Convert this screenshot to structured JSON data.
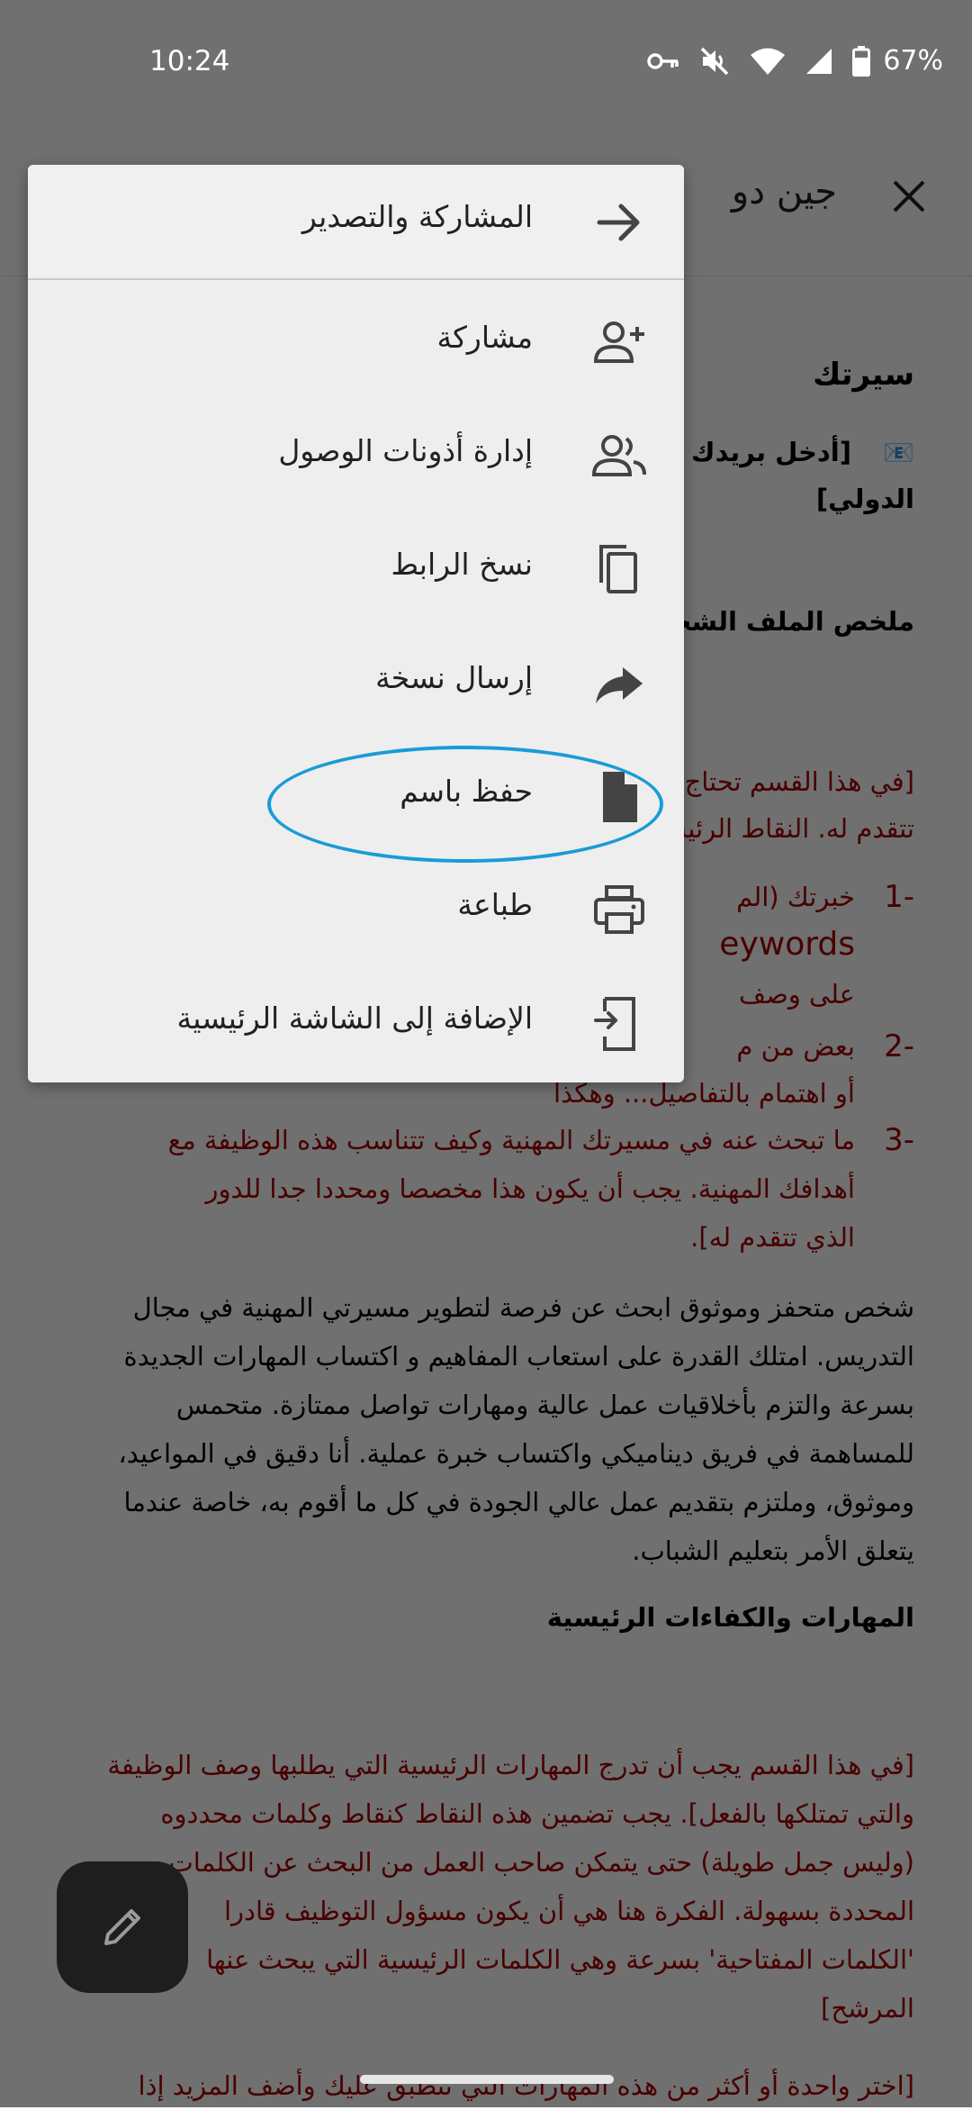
{
  "status": {
    "time": "10:24",
    "battery": "67%"
  },
  "document": {
    "title": "جين دو",
    "heading": "سيرتك",
    "email_line_1": "[أدخل بريدك ا",
    "email_line_2": "الدولي]",
    "section_profile": "ملخص الملف الشخص",
    "profile_note_1": "[في هذا القسم تحتاج",
    "profile_note_2": "تتقدم له. النقاط الرئيسي",
    "list_1a": "خبرتك (الم",
    "list_1b": "eywords",
    "list_1c": "على وصف",
    "list_2a": "بعض من م",
    "list_2b": "أو اهتمام بالتفاصيل... وهكذا",
    "list_3a": "ما تبحث عنه في مسيرتك المهنية وكيف تتناسب هذه الوظيفة مع",
    "list_3b": "أهدافك المهنية. يجب أن يكون هذا مخصصا ومحددا جدا للدور",
    "list_3c": "الذي تتقدم له].",
    "num_1": "-1",
    "num_2": "-2",
    "num_3": "-3",
    "summary_1": "شخص متحفز وموثوق ابحث عن فرصة لتطوير مسيرتي المهنية في مجال",
    "summary_2": "التدريس. امتلك القدرة على استعاب المفاهيم و اكتساب المهارات الجديدة",
    "summary_3": "بسرعة والتزم بأخلاقيات عمل عالية ومهارات تواصل ممتازة. متحمس",
    "summary_4": "للمساهمة في فريق ديناميكي واكتساب خبرة عملية. أنا دقيق في المواعيد،",
    "summary_5": "وموثوق، وملتزم بتقديم عمل عالي الجودة في كل ما أقوم به، خاصة عندما",
    "summary_6": "يتعلق الأمر بتعليم الشباب.",
    "section_skills": "المهارات والكفاءات الرئيسية",
    "skills_1": "[في هذا القسم يجب أن تدرج المهارات الرئيسية التي يطلبها وصف الوظيفة",
    "skills_2": "والتي تمتلكها بالفعل]. يجب تضمين هذه النقاط كنقاط وكلمات محددوه",
    "skills_3": "(وليس جمل طويلة) حتى يتمكن صاحب العمل من البحث عن الكلمات",
    "skills_4": "المحددة بسهولة. الفكرة هنا هي أن يكون مسؤول التوظيف قادرا",
    "skills_5": "'الكلمات المفتاحية' بسرعة وهي الكلمات الرئيسية التي يبحث عنها",
    "skills_6": "المرشح]",
    "skills_7": "[اختر واحدة أو أكثر من هذه المهارات التي تنطبق عليك وأضف المزيد إذا"
  },
  "menu": {
    "header": "المشاركة والتصدير",
    "items": [
      {
        "label": "مشاركة",
        "icon": "person-add-icon"
      },
      {
        "label": "إدارة أذونات الوصول",
        "icon": "people-icon"
      },
      {
        "label": "نسخ الرابط",
        "icon": "copy-icon"
      },
      {
        "label": "إرسال نسخة",
        "icon": "forward-icon"
      },
      {
        "label": "حفظ باسم",
        "icon": "file-icon"
      },
      {
        "label": "طباعة",
        "icon": "print-icon"
      },
      {
        "label": "الإضافة إلى الشاشة الرئيسية",
        "icon": "add-to-home-icon"
      }
    ]
  },
  "colors": {
    "highlight": "#1a9bd7",
    "note_red": "#a50000"
  }
}
